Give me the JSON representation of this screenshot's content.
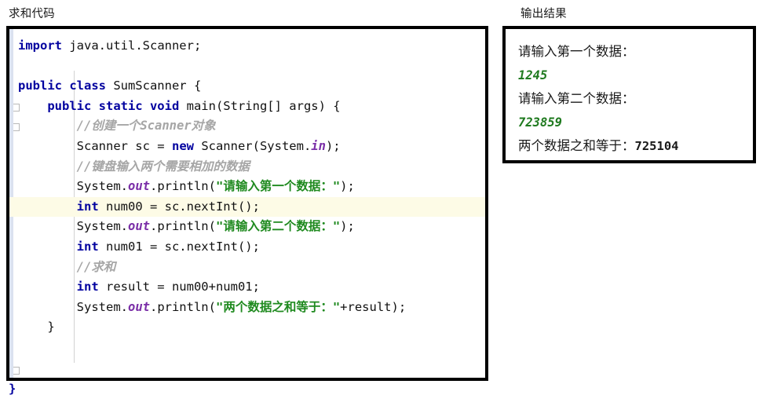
{
  "panels": {
    "code": {
      "caption": "求和代码",
      "lines": [
        {
          "id": "line-1",
          "indent": 0,
          "highlight": false,
          "tokens": [
            {
              "type": "kw",
              "text": "import"
            },
            {
              "type": "pl",
              "text": " java.util.Scanner;"
            }
          ]
        },
        {
          "id": "line-2",
          "indent": 0,
          "highlight": false,
          "tokens": []
        },
        {
          "id": "line-3",
          "indent": 0,
          "highlight": false,
          "tokens": [
            {
              "type": "kw",
              "text": "public class"
            },
            {
              "type": "pl",
              "text": " SumScanner {"
            }
          ]
        },
        {
          "id": "line-4",
          "indent": 1,
          "highlight": false,
          "tokens": [
            {
              "type": "kw",
              "text": "public static void"
            },
            {
              "type": "pl",
              "text": " main(String[] args) {"
            }
          ]
        },
        {
          "id": "line-5",
          "indent": 2,
          "highlight": false,
          "tokens": [
            {
              "type": "cmt",
              "text": "//创建一个Scanner对象"
            }
          ]
        },
        {
          "id": "line-6",
          "indent": 2,
          "highlight": false,
          "tokens": [
            {
              "type": "pl",
              "text": "Scanner sc = "
            },
            {
              "type": "kw",
              "text": "new"
            },
            {
              "type": "pl",
              "text": " Scanner(System."
            },
            {
              "type": "fld",
              "text": "in"
            },
            {
              "type": "pl",
              "text": ");"
            }
          ]
        },
        {
          "id": "line-7",
          "indent": 2,
          "highlight": false,
          "tokens": [
            {
              "type": "cmt",
              "text": "//键盘输入两个需要相加的数据"
            }
          ]
        },
        {
          "id": "line-8",
          "indent": 2,
          "highlight": false,
          "tokens": [
            {
              "type": "pl",
              "text": "System."
            },
            {
              "type": "fld",
              "text": "out"
            },
            {
              "type": "pl",
              "text": ".println("
            },
            {
              "type": "str",
              "text": "\"请输入第一个数据："
            },
            {
              "type": "str",
              "text": "\""
            },
            {
              "type": "pl",
              "text": ");"
            }
          ]
        },
        {
          "id": "line-9",
          "indent": 2,
          "highlight": true,
          "tokens": [
            {
              "type": "kw",
              "text": "int"
            },
            {
              "type": "pl",
              "text": " num00 = sc.nextInt();"
            }
          ]
        },
        {
          "id": "line-10",
          "indent": 2,
          "highlight": false,
          "tokens": [
            {
              "type": "pl",
              "text": "System."
            },
            {
              "type": "fld",
              "text": "out"
            },
            {
              "type": "pl",
              "text": ".println("
            },
            {
              "type": "str",
              "text": "\"请输入第二个数据："
            },
            {
              "type": "str",
              "text": "\""
            },
            {
              "type": "pl",
              "text": ");"
            }
          ]
        },
        {
          "id": "line-11",
          "indent": 2,
          "highlight": false,
          "tokens": [
            {
              "type": "kw",
              "text": "int"
            },
            {
              "type": "pl",
              "text": " num01 = sc.nextInt();"
            }
          ]
        },
        {
          "id": "line-12",
          "indent": 2,
          "highlight": false,
          "tokens": [
            {
              "type": "cmt",
              "text": "//求和"
            }
          ]
        },
        {
          "id": "line-13",
          "indent": 2,
          "highlight": false,
          "tokens": [
            {
              "type": "kw",
              "text": "int"
            },
            {
              "type": "pl",
              "text": " result = num00+num01;"
            }
          ]
        },
        {
          "id": "line-14",
          "indent": 2,
          "highlight": false,
          "tokens": [
            {
              "type": "pl",
              "text": "System."
            },
            {
              "type": "fld",
              "text": "out"
            },
            {
              "type": "pl",
              "text": ".println("
            },
            {
              "type": "str",
              "text": "\"两个数据之和等于："
            },
            {
              "type": "str",
              "text": "\""
            },
            {
              "type": "pl",
              "text": "+result);"
            }
          ]
        },
        {
          "id": "line-15",
          "indent": 1,
          "highlight": false,
          "tokens": [
            {
              "type": "pl",
              "text": "}"
            }
          ]
        }
      ],
      "trailing_brace": "}"
    },
    "output": {
      "caption": "输出结果",
      "lines": [
        {
          "id": "out-prompt-1",
          "kind": "prompt",
          "text": "请输入第一个数据："
        },
        {
          "id": "out-value-1",
          "kind": "value",
          "text": "1245"
        },
        {
          "id": "out-prompt-2",
          "kind": "prompt",
          "text": "请输入第二个数据："
        },
        {
          "id": "out-value-2",
          "kind": "value",
          "text": "723859"
        },
        {
          "id": "out-sum",
          "kind": "sum",
          "label": "两个数据之和等于：",
          "value": "725104"
        }
      ]
    }
  },
  "colors": {
    "keyword": "#00009f",
    "string": "#1f8a1f",
    "comment": "#a6a6a6",
    "field": "#7b2fa8",
    "plain": "#111111",
    "highlight_line": "#fdfbe6",
    "border": "#000000",
    "gutter_strip": "#dbe2f0",
    "output_value": "#1f7a1f",
    "page_background": "#ffffff"
  }
}
